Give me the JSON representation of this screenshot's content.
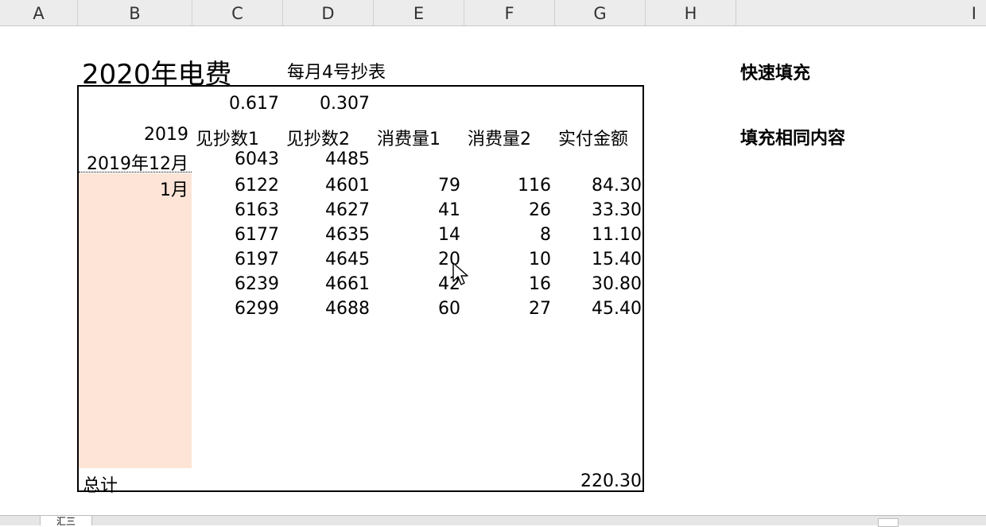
{
  "columns": [
    "A",
    "B",
    "C",
    "D",
    "E",
    "F",
    "G",
    "H",
    "I"
  ],
  "title": "2020年电费",
  "subtitle": "每月4号抄表",
  "side_notes": [
    "快速填充",
    "填充相同内容"
  ],
  "rates": [
    "0.617",
    "0.307"
  ],
  "header_row": {
    "year": "2019",
    "cols": [
      "见抄数1",
      "见抄数2",
      "消费量1",
      "消费量2",
      "实付金额"
    ]
  },
  "base_row": {
    "label": "2019年12月",
    "c": "6043",
    "d": "4485"
  },
  "rows": [
    {
      "label": "1月",
      "c": "6122",
      "d": "4601",
      "e": "79",
      "f": "116",
      "g": "84.30"
    },
    {
      "label": "",
      "c": "6163",
      "d": "4627",
      "e": "41",
      "f": "26",
      "g": "33.30"
    },
    {
      "label": "",
      "c": "6177",
      "d": "4635",
      "e": "14",
      "f": "8",
      "g": "11.10"
    },
    {
      "label": "",
      "c": "6197",
      "d": "4645",
      "e": "20",
      "f": "10",
      "g": "15.40"
    },
    {
      "label": "",
      "c": "6239",
      "d": "4661",
      "e": "42",
      "f": "16",
      "g": "30.80"
    },
    {
      "label": "",
      "c": "6299",
      "d": "4688",
      "e": "60",
      "f": "27",
      "g": "45.40"
    }
  ],
  "total": {
    "label": "总计",
    "value": "220.30"
  },
  "sheet_tab": "汇三",
  "colors": {
    "shade": "#fde4d7",
    "header_bg": "#ececec"
  }
}
